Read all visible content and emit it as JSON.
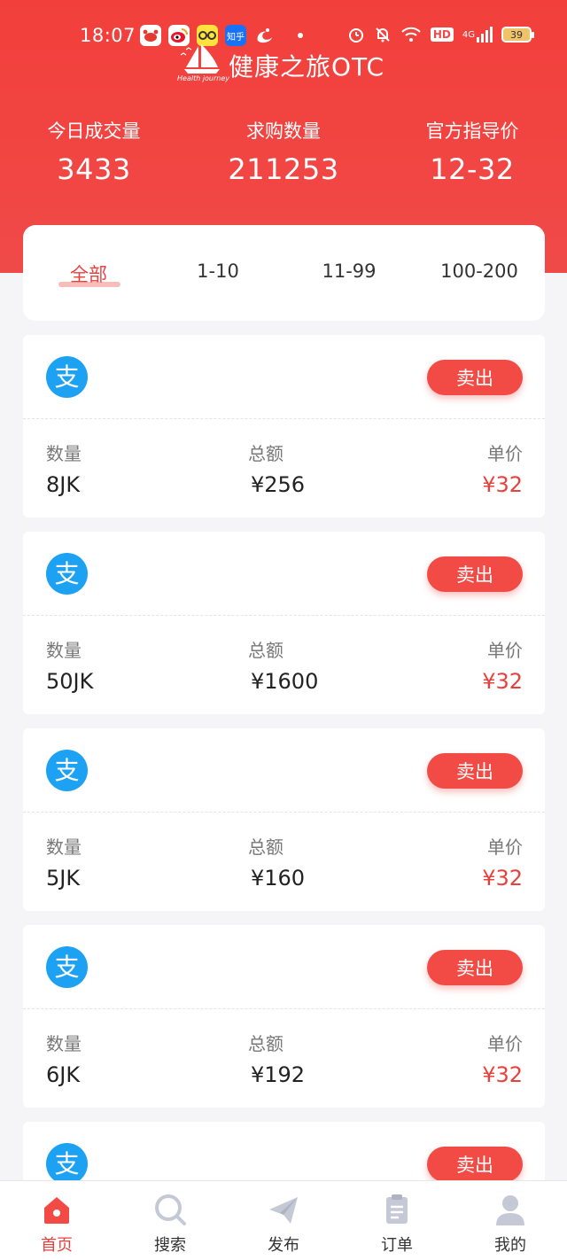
{
  "status_bar": {
    "time": "18:07",
    "app_zhihu": "知乎",
    "network": "4G",
    "hd": "HD",
    "battery": "39"
  },
  "brand": {
    "logo_subtitle": "Health journey",
    "title": "健康之旅OTC"
  },
  "stats": [
    {
      "label": "今日成交量",
      "value": "3433"
    },
    {
      "label": "求购数量",
      "value": "211253"
    },
    {
      "label": "官方指导价",
      "value": "12-32"
    }
  ],
  "filter_tabs": [
    "全部",
    "1-10",
    "11-99",
    "100-200"
  ],
  "active_tab": "全部",
  "listing": {
    "sell_label": "卖出",
    "quantity_label": "数量",
    "total_label": "总额",
    "price_label": "单价",
    "payment_method_icon": "alipay-icon",
    "items": [
      {
        "quantity": "8JK",
        "total": "¥256",
        "price": "¥32"
      },
      {
        "quantity": "50JK",
        "total": "¥1600",
        "price": "¥32"
      },
      {
        "quantity": "5JK",
        "total": "¥160",
        "price": "¥32"
      },
      {
        "quantity": "6JK",
        "total": "¥192",
        "price": "¥32"
      },
      {
        "quantity": "",
        "total": "",
        "price": ""
      }
    ]
  },
  "bottom_nav": [
    {
      "label": "首页",
      "icon": "home-icon",
      "active": true
    },
    {
      "label": "搜索",
      "icon": "search-icon",
      "active": false
    },
    {
      "label": "发布",
      "icon": "send-icon",
      "active": false
    },
    {
      "label": "订单",
      "icon": "order-icon",
      "active": false
    },
    {
      "label": "我的",
      "icon": "user-icon",
      "active": false
    }
  ],
  "colors": {
    "primary": "#f24b45",
    "price": "#e8413d",
    "alipay": "#1da1f2",
    "background": "#f5f5f7"
  }
}
